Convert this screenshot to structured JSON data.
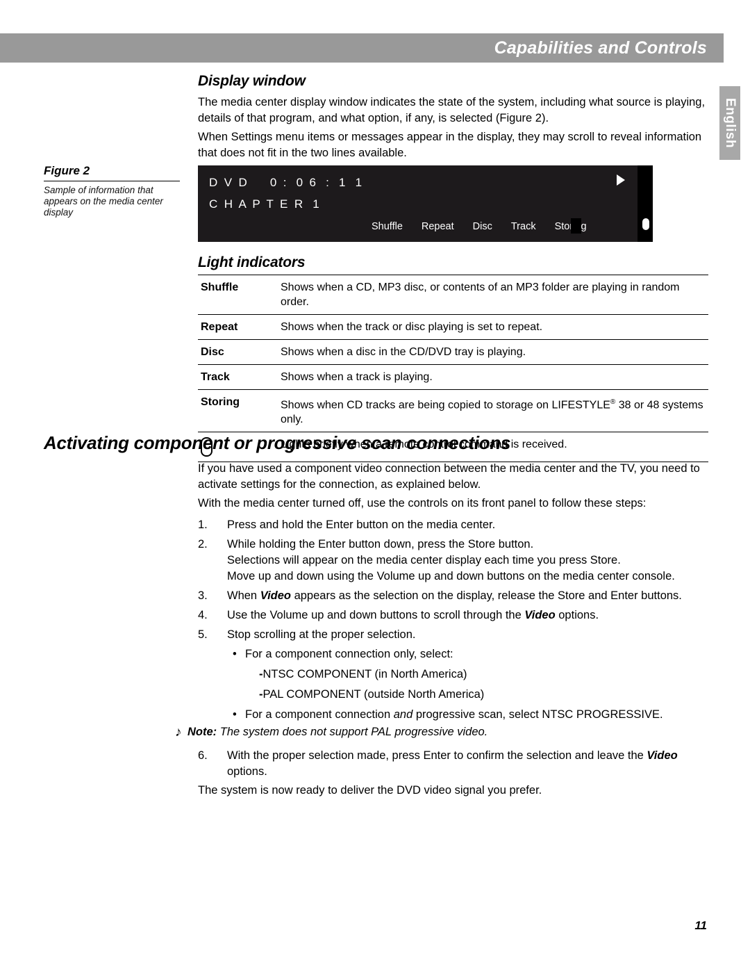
{
  "header": {
    "title": "Capabilities and Controls"
  },
  "language_tab": {
    "label": "English"
  },
  "sections": {
    "display_window": {
      "heading": "Display window",
      "paragraph1": "The media center display window indicates the state of the system, including what source is playing, details of that program, and what option, if any, is selected (Figure 2).",
      "paragraph2": "When Settings menu items or messages appear in the display, they may scroll to reveal information that does not fit in the two lines available."
    },
    "light_indicators": {
      "heading": "Light indicators",
      "rows": [
        {
          "label": "Shuffle",
          "description": "Shows when a CD, MP3 disc, or contents of an MP3 folder are playing in random order."
        },
        {
          "label": "Repeat",
          "description": "Shows when the track or disc playing is set to repeat."
        },
        {
          "label": "Disc",
          "description": "Shows when a disc in the CD/DVD tray is playing."
        },
        {
          "label": "Track",
          "description": "Shows when a track is playing."
        },
        {
          "label": "Storing",
          "description_before": "Shows when CD tracks are being copied to storage on LIFESTYLE",
          "description_reg": "®",
          "description_after": " 38 or 48 systems only."
        },
        {
          "label": "",
          "icon": "remote-oval-icon",
          "description": "Lights briefly when a remote control command is received."
        }
      ]
    },
    "activating": {
      "heading": "Activating component or progressive scan connections",
      "paragraph1": "If you have used a component video connection between the media center and the TV, you need to activate settings for the connection, as explained below.",
      "paragraph2": "With the media center turned off, use the controls on its front panel to follow these steps:",
      "steps": [
        {
          "num": "1.",
          "lines": [
            "Press and hold the Enter button on the media center."
          ]
        },
        {
          "num": "2.",
          "lines": [
            "While holding the Enter button down, press the Store button.",
            "Selections will appear on the media center display each time you press Store.",
            "Move up and down using the Volume up and down buttons on the media center console."
          ]
        },
        {
          "num": "3.",
          "parts": {
            "pre": "When ",
            "em": "Video",
            "post": " appears as the selection on the display, release the Store and Enter buttons."
          }
        },
        {
          "num": "4.",
          "parts": {
            "pre": "Use the Volume up and down buttons to scroll through the ",
            "em": "Video",
            "post": " options."
          }
        },
        {
          "num": "5.",
          "lines": [
            "Stop scrolling at the proper selection."
          ]
        }
      ],
      "bullet1": "For a component connection only, select:",
      "dash_items": [
        "NTSC COMPONENT (in North America)",
        "PAL COMPONENT (outside North America)"
      ],
      "bullet2": {
        "pre": "For a component connection ",
        "em": "and",
        "post": " progressive scan, select NTSC PROGRESSIVE."
      },
      "note": {
        "icon": "♪",
        "label": "Note:",
        "text": " The system does not support PAL progressive video."
      },
      "step6": {
        "num": "6.",
        "pre": "With the proper selection made, press Enter to confirm the selection and leave the ",
        "em": "Video",
        "post": " options."
      },
      "closing": "The system is now ready to deliver the DVD video signal you prefer."
    }
  },
  "figure": {
    "title": "Figure 2",
    "caption": "Sample of information that appears on the media center display"
  },
  "display_graphic": {
    "line1": "D  V  D       0  :   0  6   :   1   1",
    "line2": "C  H  A  P  T  E  R   1",
    "indicators": [
      "Shuffle",
      "Repeat",
      "Disc",
      "Track",
      "Storing"
    ],
    "play_icon": "play-arrow-icon",
    "remote_icon": "remote-oval-icon"
  },
  "page_number": "11"
}
